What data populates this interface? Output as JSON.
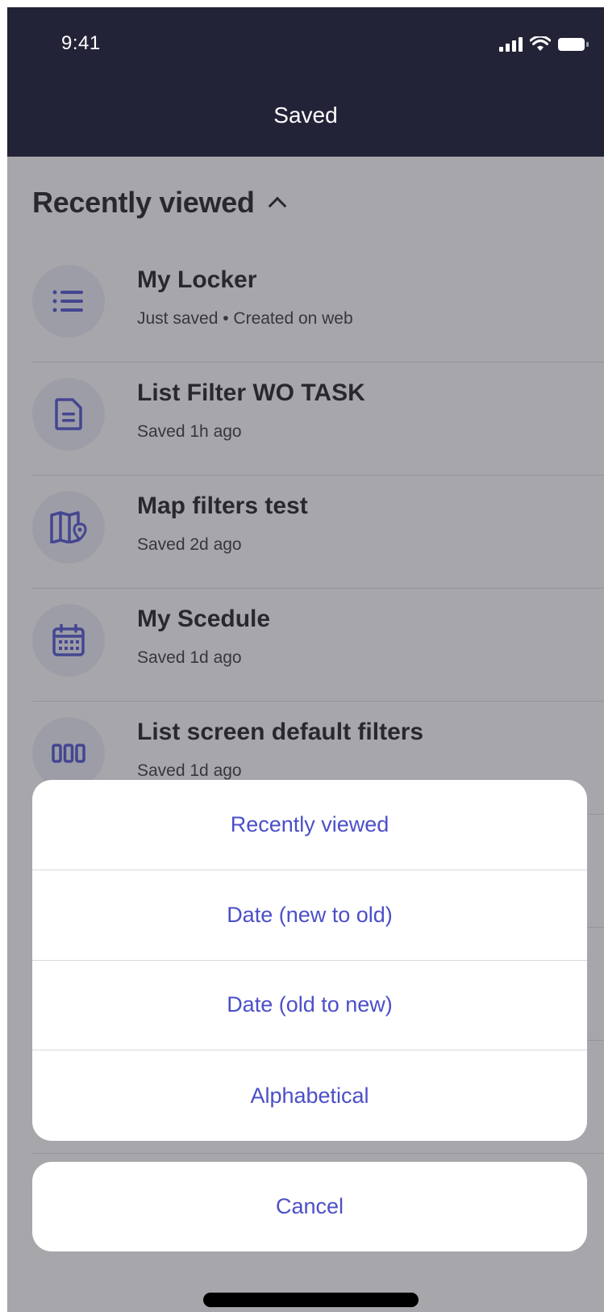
{
  "status_bar": {
    "time": "9:41"
  },
  "nav": {
    "title": "Saved"
  },
  "section": {
    "title": "Recently viewed"
  },
  "items": [
    {
      "title": "My Locker",
      "subtitle": "Just saved • Created on web",
      "icon": "list-icon"
    },
    {
      "title": "List Filter WO TASK",
      "subtitle": "Saved 1h ago",
      "icon": "document-icon"
    },
    {
      "title": "Map filters test",
      "subtitle": "Saved 2d ago",
      "icon": "map-icon"
    },
    {
      "title": "My Scedule",
      "subtitle": "Saved 1d ago",
      "icon": "calendar-icon"
    },
    {
      "title": "List screen default filters",
      "subtitle": "Saved 1d ago",
      "icon": "columns-icon"
    }
  ],
  "sort_sheet": {
    "options": [
      "Recently viewed",
      "Date (new to old)",
      "Date (old to new)",
      "Alphabetical"
    ],
    "cancel": "Cancel"
  },
  "colors": {
    "header": "#222337",
    "accent": "#4c4fc8",
    "icon_bg": "#e3e3f2"
  }
}
